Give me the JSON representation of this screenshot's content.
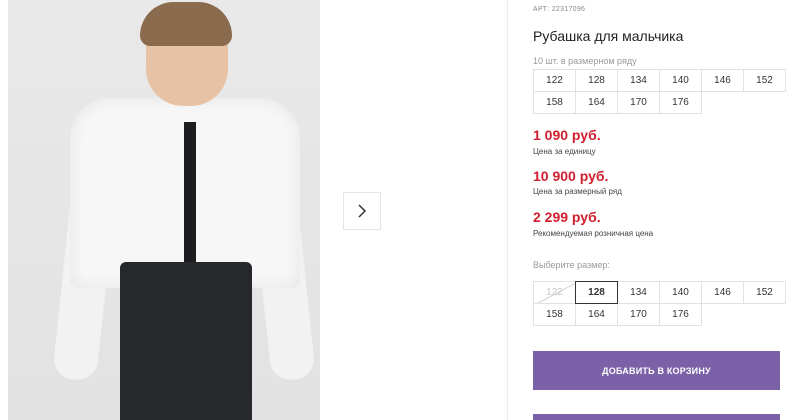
{
  "product": {
    "article": "АРТ: 22317096",
    "title": "Рубашка для мальчика",
    "sizes_note": "10 шт. в размерном ряду",
    "sizes_info": [
      "122",
      "128",
      "134",
      "140",
      "146",
      "152",
      "158",
      "164",
      "170",
      "176"
    ]
  },
  "prices": {
    "unit_price": "1 090 руб.",
    "unit_label": "Цена за единицу",
    "row_price": "10 900 руб.",
    "row_label": "Цена за размерный ряд",
    "retail_price": "2 299 руб.",
    "retail_label": "Рекомендуемая розничная цена",
    "price_color": "#d01f2e"
  },
  "size_picker": {
    "label": "Выберите размер:",
    "options": [
      "122",
      "128",
      "134",
      "140",
      "146",
      "152",
      "158",
      "164",
      "170",
      "176"
    ],
    "selected": "128",
    "disabled": [
      "122"
    ]
  },
  "actions": {
    "add_to_cart": "ДОБАВИТЬ В КОРЗИНУ",
    "button_color": "#7b62a8"
  },
  "gallery": {
    "next_icon": "chevron-right-icon"
  }
}
